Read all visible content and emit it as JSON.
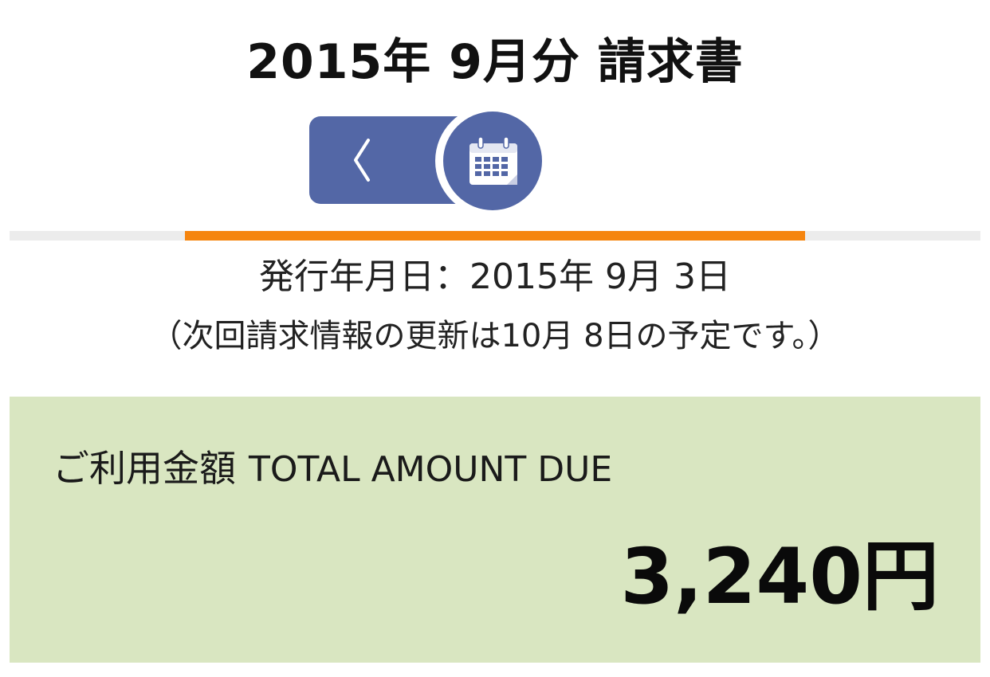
{
  "header": {
    "title": "2015年 9月分 請求書"
  },
  "navigation": {
    "prev_icon": "chevron-left-icon",
    "calendar_icon": "calendar-icon",
    "accent_color": "#5367a6",
    "tab_color": "#f5850f"
  },
  "invoice": {
    "issue_date": "発行年月日：2015年 9月 3日",
    "next_update_note": "（次回請求情報の更新は10月 8日の予定です。）"
  },
  "total": {
    "label_ja": "ご利用金額",
    "label_en": "TOTAL AMOUNT DUE",
    "amount": "3,240円",
    "panel_color": "#d9e6c1"
  }
}
